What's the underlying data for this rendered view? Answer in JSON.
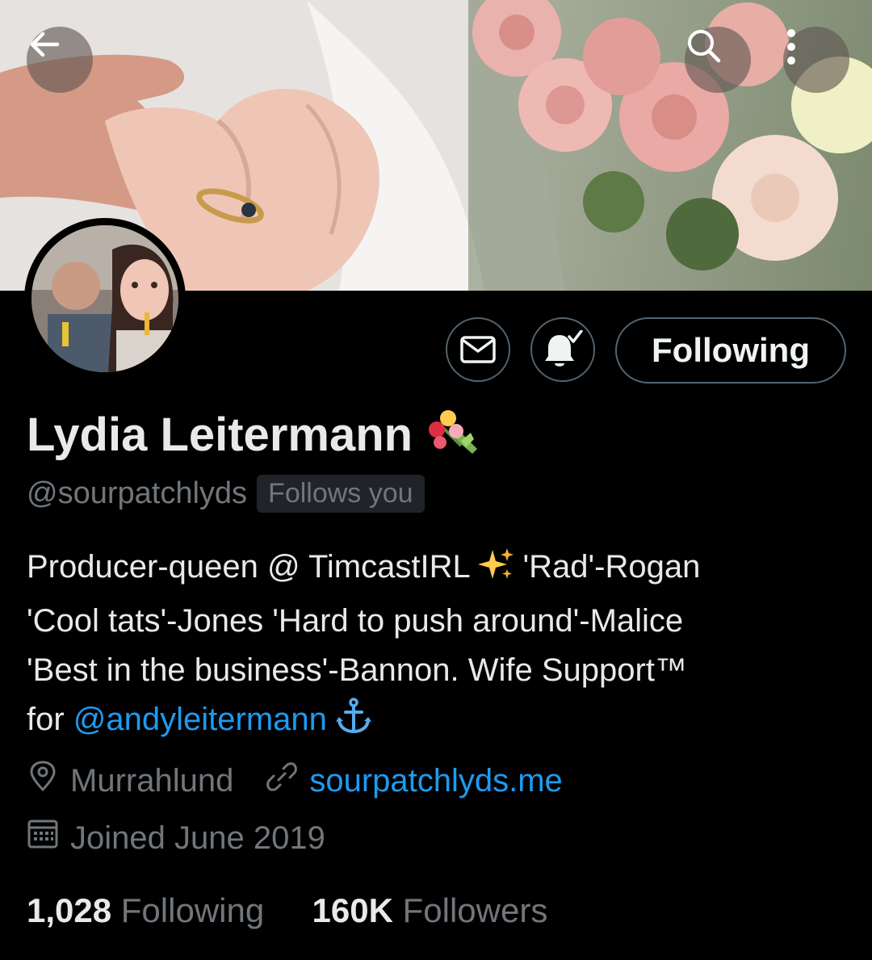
{
  "header": {
    "back_icon": "arrow-left-icon",
    "search_icon": "search-icon",
    "more_icon": "more-vertical-icon"
  },
  "profile": {
    "name": "Lydia Leitermann",
    "name_emoji": "bouquet-emoji",
    "handle": "@sourpatchlyds",
    "follows_you_badge": "Follows you",
    "bio": {
      "line1_a": "Producer-queen @ TimcastIRL ",
      "line1_emoji": "sparkles-emoji",
      "line1_b": " 'Rad'-Rogan",
      "line2": "'Cool tats'-Jones 'Hard to push around'-Malice",
      "line3": "'Best in the business'-Bannon. Wife Support™",
      "line4_a": "for ",
      "line4_mention": "@andyleitermann",
      "line4_emoji": "anchor-emoji"
    },
    "location": "Murrahlund",
    "website": "sourpatchlyds.me",
    "joined": "Joined June 2019",
    "following_count": "1,028",
    "following_label": "Following",
    "followers_count": "160K",
    "followers_label": "Followers"
  },
  "actions": {
    "message_icon": "mail-icon",
    "notifications_icon": "bell-check-icon",
    "follow_button_label": "Following"
  },
  "colors": {
    "background": "#000000",
    "text_primary": "#e7e9ea",
    "text_secondary": "#71767b",
    "link": "#1d9bf0",
    "border": "#536471"
  }
}
